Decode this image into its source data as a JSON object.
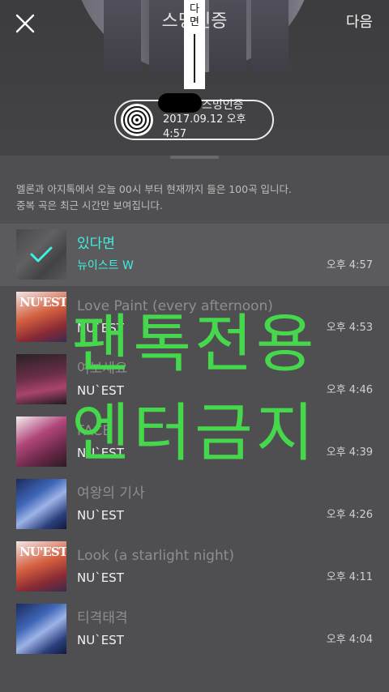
{
  "header": {
    "title": "스밍인증",
    "next_label": "다음",
    "vertical_badge_text": "다\n면",
    "close_icon": "close-icon"
  },
  "stream_pill": {
    "title_suffix": "스밍인증",
    "date": "2017.09.12 오후 4:57",
    "icon": "disc-icon"
  },
  "info_text": "멜론과 아지톡에서 오늘 00시 부터 현재까지 들은 100곡 입니다.\n중복 곡은 최근 시간만 보여집니다.",
  "songs": [
    {
      "title": "있다면",
      "artist": "뉴이스트 W",
      "time": "오후 4:57",
      "selected": true
    },
    {
      "title": "Love Paint (every afternoon)",
      "artist": "NU`EST",
      "time": "오후 4:53"
    },
    {
      "title": "여보세요",
      "artist": "NU`EST",
      "time": "오후 4:46"
    },
    {
      "title": "FACE",
      "artist": "NU`EST",
      "time": "오후 4:39"
    },
    {
      "title": "여왕의 기사",
      "artist": "NU`EST",
      "time": "오후 4:26"
    },
    {
      "title": "Look (a starlight night)",
      "artist": "NU`EST",
      "time": "오후 4:11"
    },
    {
      "title": "티격태격",
      "artist": "NU`EST",
      "time": "오후 4:04"
    }
  ],
  "album_logos": {
    "nuest": "NU'EST"
  },
  "watermark": {
    "line1": "팬톡전용",
    "line2": "엔터금지",
    "color": "#46d84c"
  },
  "colors": {
    "accent_selected": "#3ef0e0",
    "background": "#4f4f51"
  }
}
